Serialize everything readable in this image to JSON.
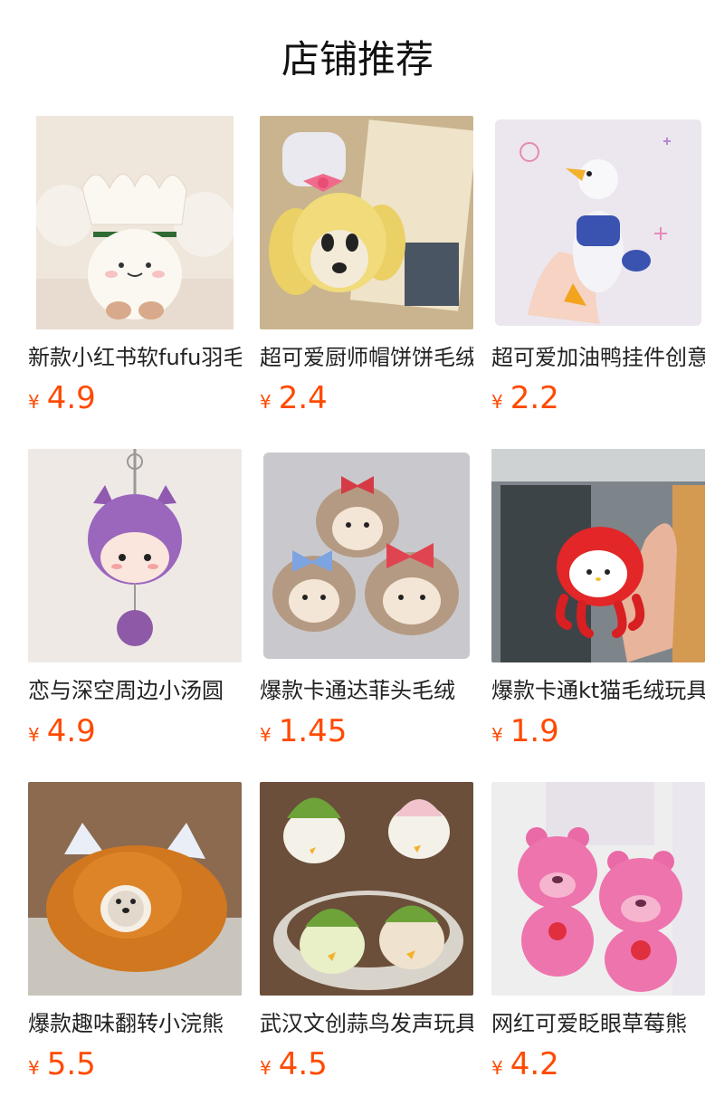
{
  "header": {
    "title": "店铺推荐"
  },
  "accent_color": "#ff4a00",
  "products": [
    {
      "name": "新款小红书软fufu羽毛",
      "currency": "¥",
      "price": "4.9",
      "image": "white-flower-plush"
    },
    {
      "name": "超可爱厨师帽饼饼毛绒",
      "currency": "¥",
      "price": "2.4",
      "image": "chef-hat-dog-plush"
    },
    {
      "name": "超可爱加油鸭挂件创意",
      "currency": "¥",
      "price": "2.2",
      "image": "duck-keychain"
    },
    {
      "name": "恋与深空周边小汤圆",
      "currency": "¥",
      "price": "4.9",
      "image": "purple-hair-keychain"
    },
    {
      "name": "爆款卡通达菲头毛绒",
      "currency": "¥",
      "price": "1.45",
      "image": "shelliemay-heads"
    },
    {
      "name": "爆款卡通kt猫毛绒玩具",
      "currency": "¥",
      "price": "1.9",
      "image": "hello-kitty-octopus"
    },
    {
      "name": "爆款趣味翻转小浣熊",
      "currency": "¥",
      "price": "5.5",
      "image": "red-panda-plush"
    },
    {
      "name": "武汉文创蒜鸟发声玩具",
      "currency": "¥",
      "price": "4.5",
      "image": "garlic-bird-plush"
    },
    {
      "name": "网红可爱眨眼草莓熊",
      "currency": "¥",
      "price": "4.2",
      "image": "lotso-bear-plush"
    }
  ]
}
